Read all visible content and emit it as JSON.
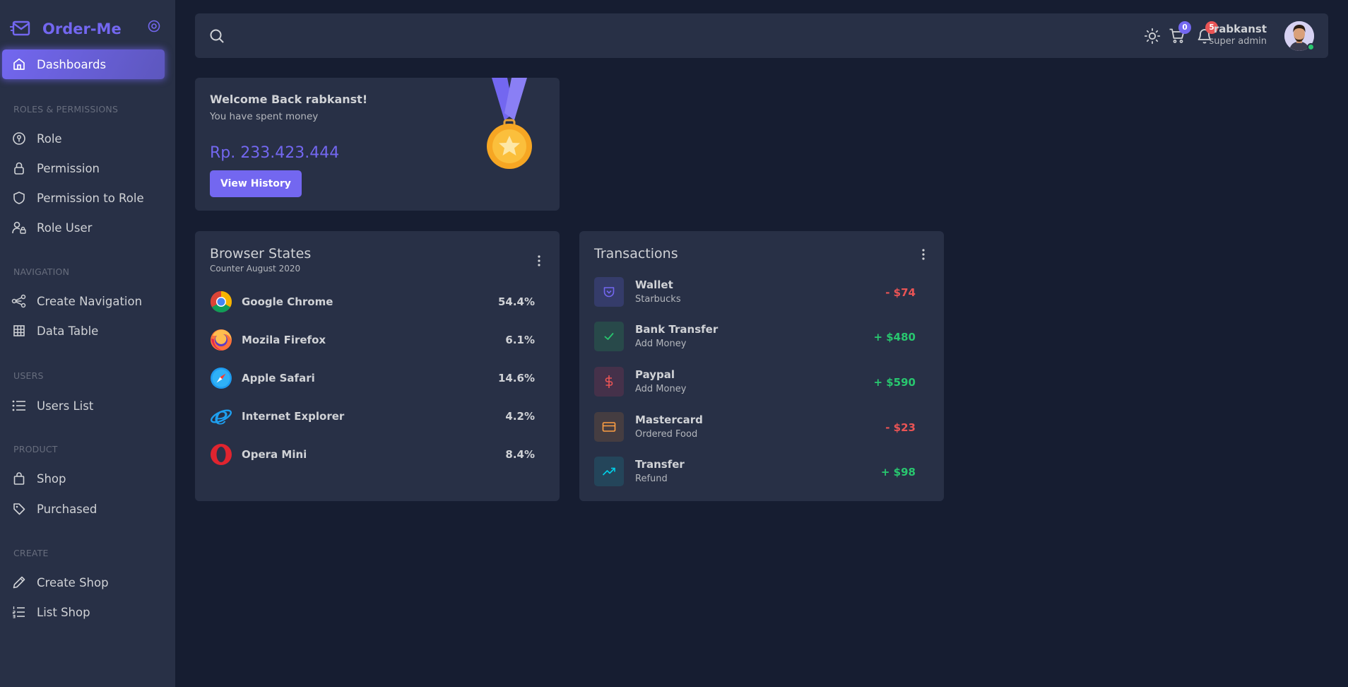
{
  "brand": {
    "name": "Order-Me"
  },
  "sidebar": {
    "active": {
      "label": "Dashboards",
      "icon": "home-icon"
    },
    "sections": [
      {
        "header": "ROLES & PERMISSIONS",
        "items": [
          {
            "label": "Role",
            "icon": "key-circle-icon"
          },
          {
            "label": "Permission",
            "icon": "lock-icon"
          },
          {
            "label": "Permission to Role",
            "icon": "shield-icon"
          },
          {
            "label": "Role User",
            "icon": "user-lock-icon"
          }
        ]
      },
      {
        "header": "NAVIGATION",
        "items": [
          {
            "label": "Create Navigation",
            "icon": "share-nodes-icon"
          },
          {
            "label": "Data Table",
            "icon": "table-icon"
          }
        ]
      },
      {
        "header": "USERS",
        "items": [
          {
            "label": "Users List",
            "icon": "list-icon"
          }
        ]
      },
      {
        "header": "PRODUCT",
        "items": [
          {
            "label": "Shop",
            "icon": "shopping-bag-icon"
          },
          {
            "label": "Purchased",
            "icon": "tag-icon"
          }
        ]
      },
      {
        "header": "CREATE",
        "items": [
          {
            "label": "Create Shop",
            "icon": "pencil-icon"
          },
          {
            "label": "List Shop",
            "icon": "ordered-list-icon"
          }
        ]
      }
    ]
  },
  "header": {
    "cart_count": "0",
    "notification_count": "5",
    "user_name": "rabkanst",
    "user_role": "super admin"
  },
  "welcome": {
    "title": "Welcome Back rabkanst!",
    "subtitle": "You have spent money",
    "amount": "Rp. 233.423.444",
    "button_label": "View History"
  },
  "browser_states": {
    "title": "Browser States",
    "subtitle": "Counter August 2020",
    "rows": [
      {
        "name": "Google Chrome",
        "value": "54.4%"
      },
      {
        "name": "Mozila Firefox",
        "value": "6.1%"
      },
      {
        "name": "Apple Safari",
        "value": "14.6%"
      },
      {
        "name": "Internet Explorer",
        "value": "4.2%"
      },
      {
        "name": "Opera Mini",
        "value": "8.4%"
      }
    ]
  },
  "transactions": {
    "title": "Transactions",
    "rows": [
      {
        "name": "Wallet",
        "sub": "Starbucks",
        "amount": "- $74",
        "icon": "wallet-icon"
      },
      {
        "name": "Bank Transfer",
        "sub": "Add Money",
        "amount": "+ $480",
        "icon": "check-icon"
      },
      {
        "name": "Paypal",
        "sub": "Add Money",
        "amount": "+ $590",
        "icon": "dollar-icon"
      },
      {
        "name": "Mastercard",
        "sub": "Ordered Food",
        "amount": "- $23",
        "icon": "credit-card-icon"
      },
      {
        "name": "Transfer",
        "sub": "Refund",
        "amount": "+ $98",
        "icon": "trending-up-icon"
      }
    ]
  },
  "colors": {
    "primary": "#7367f0",
    "success": "#28c76f",
    "danger": "#ea5455",
    "warning": "#ff9f43",
    "info": "#00cfe8"
  }
}
